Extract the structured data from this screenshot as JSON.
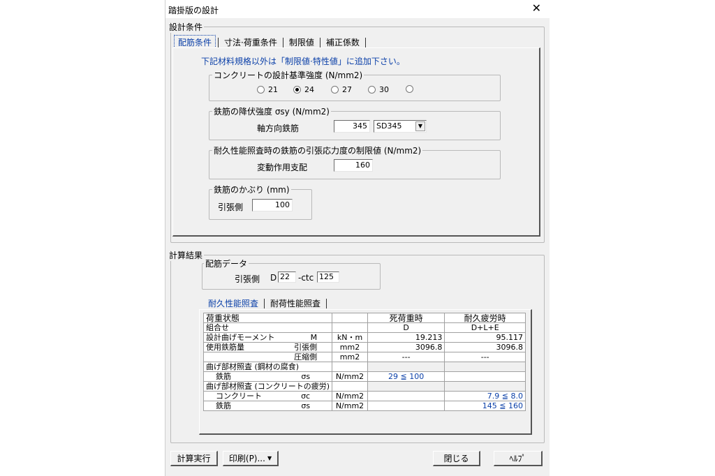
{
  "window": {
    "title": "踏掛版の設計",
    "close_glyph": "✕"
  },
  "design": {
    "group_label": "設計条件",
    "tabs": [
      "配筋条件",
      "寸法·荷重条件",
      "制限値",
      "補正係数"
    ],
    "note": "下記材料規格以外は「制限値·特性値」に追加下さい。",
    "concrete": {
      "label": "コンクリートの設計基準強度 (N/mm2)",
      "options": [
        "21",
        "24",
        "27",
        "30",
        ""
      ],
      "selected_index": 1
    },
    "yield": {
      "label": "鉄筋の降伏強度 σsy (N/mm2)",
      "axial_label": "軸方向鉄筋",
      "axial_value": "345",
      "grade": "SD345"
    },
    "durability": {
      "label": "耐久性能照査時の鉄筋の引張応力度の制限値 (N/mm2)",
      "row_label": "変動作用支配",
      "value": "160"
    },
    "cover": {
      "label": "鉄筋のかぶり (mm)",
      "row_label": "引張側",
      "value": "100"
    }
  },
  "results": {
    "group_label": "計算結果",
    "rebar": {
      "label": "配筋データ",
      "row_label": "引張側",
      "d_prefix": "D",
      "d_value": "22",
      "ctc_label": "-ctc",
      "ctc_value": "125"
    },
    "tabs": [
      "耐久性能照査",
      "耐荷性能照査"
    ],
    "table": {
      "header": [
        "荷重状態",
        "",
        "死荷重時",
        "耐久疲労時"
      ],
      "combo": [
        "組合せ",
        "",
        "D",
        "D+L+E"
      ],
      "moment": {
        "label": "設計曲げモーメント",
        "symbol": "M",
        "unit": "kN・m",
        "v1": "19.213",
        "v2": "95.117"
      },
      "steel_amount": {
        "label": "使用鉄筋量",
        "sub": "引張側",
        "unit": "mm2",
        "v1": "3096.8",
        "v2": "3096.8"
      },
      "compression": {
        "sub": "圧縮側",
        "unit": "mm2",
        "v1": "---",
        "v2": "---"
      },
      "sec1": "曲げ部材照査 (鋼材の腐食)",
      "s1_steel": {
        "label": "鉄筋",
        "symbol": "σs",
        "unit": "N/mm2",
        "v1": "29 ≦ 100",
        "v2": ""
      },
      "sec2": "曲げ部材照査 (コンクリートの疲労)",
      "s2_concrete": {
        "label": "コンクリート",
        "symbol": "σc",
        "unit": "N/mm2",
        "v1": "",
        "v2": "7.9 ≦ 8.0"
      },
      "s2_steel": {
        "label": "鉄筋",
        "symbol": "σs",
        "unit": "N/mm2",
        "v1": "",
        "v2": "145 ≦ 160"
      }
    }
  },
  "buttons": {
    "calc": "計算実行",
    "print": "印刷(P)...",
    "close": "閉じる",
    "help": "ﾍﾙﾌﾟ"
  }
}
